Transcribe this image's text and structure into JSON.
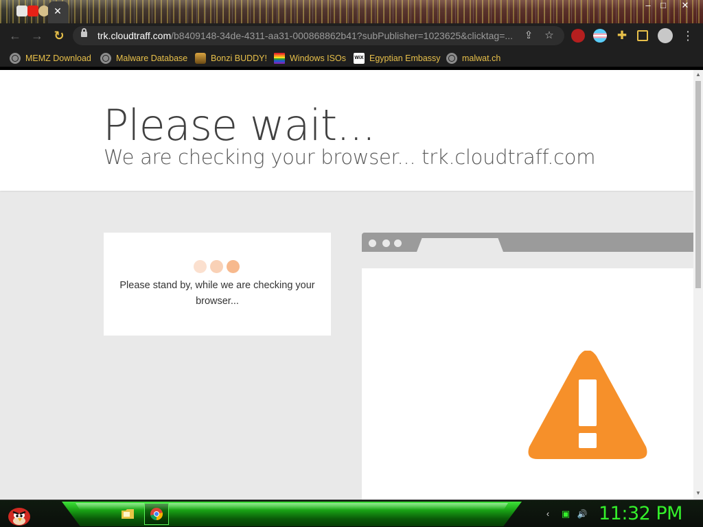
{
  "browser": {
    "active_tab": {
      "close_glyph": "✕"
    },
    "window_controls": {
      "minimize": "–",
      "maximize": "□",
      "close": "✕"
    },
    "url": {
      "host": "trk.cloudtraff.com",
      "path": "/b8409148-34de-4311-aa31-000868862b41?subPublisher=1023625&clicktag=..."
    },
    "nav": {
      "back": "←",
      "forward": "→",
      "reload": "↻"
    },
    "omnibox_icons": {
      "share": "⇪",
      "star": "☆"
    },
    "menu_glyph": "⋮",
    "bookmarks": [
      {
        "label": "MEMZ Download",
        "icon": "globe-icon"
      },
      {
        "label": "Malware Database",
        "icon": "globe-icon"
      },
      {
        "label": "Bonzi BUDDY!",
        "icon": "bonzi-icon"
      },
      {
        "label": "Windows ISOs",
        "icon": "rainbow-icon"
      },
      {
        "label": "Egyptian Embassy",
        "icon": "wix-icon"
      },
      {
        "label": "malwat.ch",
        "icon": "globe-icon"
      }
    ],
    "wix_text": "WiX"
  },
  "page": {
    "headline": "Please wait...",
    "subhead": "We are checking your browser... trk.cloudtraff.com",
    "standby_message": "Please stand by, while we are checking your browser...",
    "loading_dot_colors": [
      "#fbe0cf",
      "#f9d1b6",
      "#f7b98d"
    ],
    "warning_color": "#f6902a"
  },
  "taskbar": {
    "clock": "11:32 PM",
    "tray": {
      "network": "▣",
      "volume": "🔊",
      "chevron": "‹"
    },
    "glow_color": "#34f02b"
  }
}
